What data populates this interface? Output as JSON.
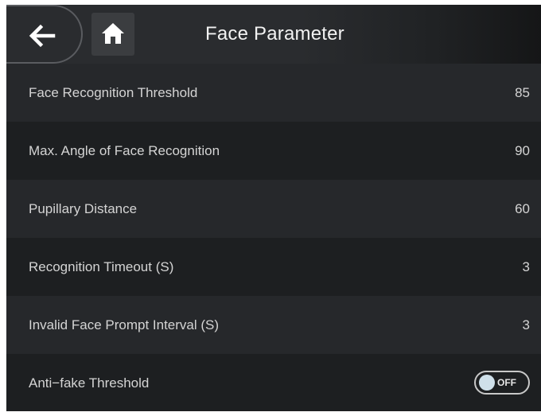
{
  "header": {
    "title": "Face Parameter",
    "back_icon": "arrow-left-icon",
    "home_icon": "home-icon"
  },
  "settings": [
    {
      "label": "Face Recognition Threshold",
      "value": "85"
    },
    {
      "label": "Max. Angle of Face Recognition",
      "value": "90"
    },
    {
      "label": "Pupillary Distance",
      "value": "60"
    },
    {
      "label": "Recognition Timeout (S)",
      "value": "3"
    },
    {
      "label": "Invalid Face Prompt Interval (S)",
      "value": "3"
    }
  ],
  "anti_fake": {
    "label": "Anti−fake Threshold",
    "toggle_text": "OFF",
    "enabled": false
  },
  "colors": {
    "background": "#1d1f21",
    "row_alt": "#26282b",
    "text": "#d4d4d4",
    "toggle_knob": "#cfe0ea"
  }
}
